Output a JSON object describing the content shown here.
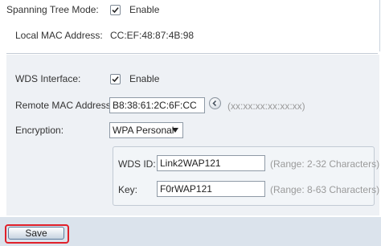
{
  "spanning_tree": {
    "label": "Spanning Tree Mode:",
    "checked": true,
    "option_label": "Enable"
  },
  "local_mac": {
    "label": "Local MAC Address:",
    "value": "CC:EF:48:87:4B:98"
  },
  "wds_interface": {
    "label": "WDS Interface:",
    "checked": true,
    "option_label": "Enable"
  },
  "remote_mac": {
    "label": "Remote MAC Address:",
    "value": "B8:38:61:2C:6F:CC",
    "hint": "(xx:xx:xx:xx:xx:xx)"
  },
  "encryption": {
    "label": "Encryption:",
    "selected": "WPA Personal"
  },
  "wds_id": {
    "label": "WDS ID:",
    "value": "Link2WAP121",
    "hint": "(Range: 2-32 Characters)"
  },
  "key": {
    "label": "Key:",
    "value": "F0rWAP121",
    "hint": "(Range: 8-63 Characters)"
  },
  "actions": {
    "save_label": "Save"
  }
}
